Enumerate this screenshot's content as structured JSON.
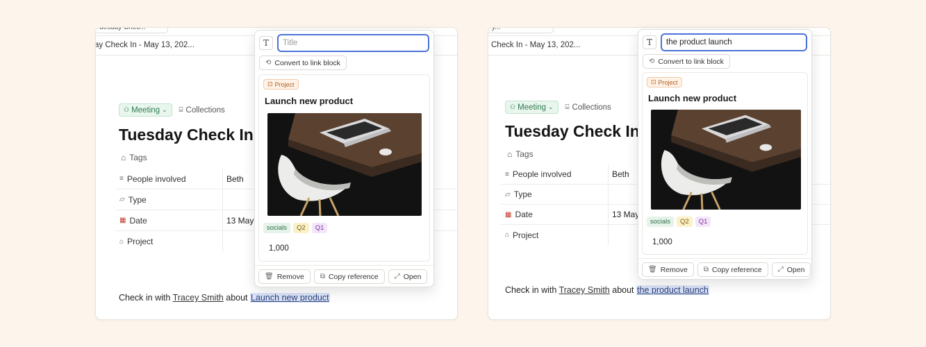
{
  "left": {
    "tab_chip": "uesday Chec...",
    "crumb": "ay Check In - May 13, 202...",
    "meeting_label": "Meeting",
    "collections_label": "Collections",
    "doc_title": "Tuesday Check In ·",
    "tags_label": "Tags",
    "properties": [
      {
        "name": "People involved",
        "value": "Beth"
      },
      {
        "name": "Type",
        "value": ""
      },
      {
        "name": "Date",
        "value": "13 May"
      },
      {
        "name": "Project",
        "value": ""
      }
    ],
    "body": {
      "prefix": "Check in with",
      "person": "Tracey Smith",
      "middle": "about",
      "link": "Launch new product"
    },
    "popover": {
      "title_value": "",
      "title_placeholder": "Title",
      "convert_label": "Convert to link block",
      "badge": "Project",
      "card_title": "Launch new product",
      "tags": [
        "socials",
        "Q2",
        "Q1"
      ],
      "number": "1,000",
      "remove_label": "Remove",
      "copy_label": "Copy reference",
      "open_label": "Open"
    }
  },
  "right": {
    "tab_chip": "y...",
    "crumb": "Check In - May 13, 202...",
    "meeting_label": "Meeting",
    "collections_label": "Collections",
    "doc_title": "Tuesday Check In ·",
    "tags_label": "Tags",
    "properties": [
      {
        "name": "People involved",
        "value": "Beth"
      },
      {
        "name": "Type",
        "value": ""
      },
      {
        "name": "Date",
        "value": "13 May"
      },
      {
        "name": "Project",
        "value": ""
      }
    ],
    "body": {
      "prefix": "Check in with",
      "person": "Tracey Smith",
      "middle": "about",
      "link": "the product launch"
    },
    "popover": {
      "title_value": "the product launch",
      "title_placeholder": "Title",
      "convert_label": "Convert to link block",
      "badge": "Project",
      "card_title": "Launch new product",
      "tags": [
        "socials",
        "Q2",
        "Q1"
      ],
      "number": "1,000",
      "remove_label": "Remove",
      "copy_label": "Copy reference",
      "open_label": "Open"
    }
  },
  "colors": {
    "background": "#fdf5ec",
    "accent": "#4a72d6",
    "meeting_green": "#2f7a4f",
    "project_orange": "#b35a1a"
  }
}
